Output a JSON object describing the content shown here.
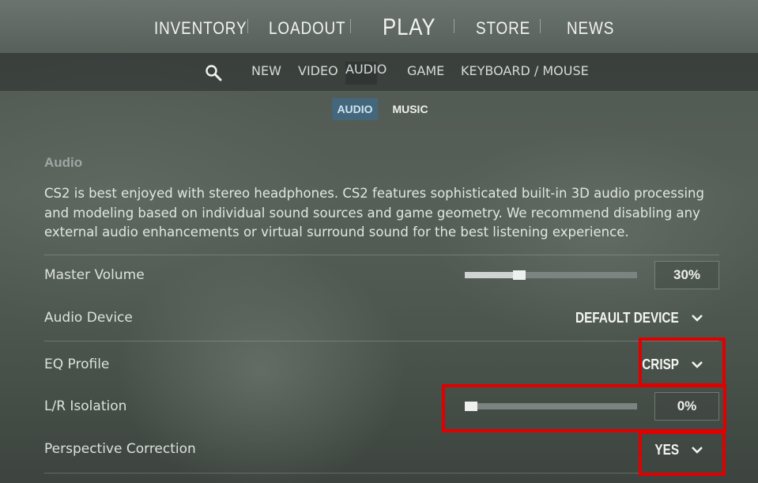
{
  "top_nav": {
    "items": [
      "INVENTORY",
      "LOADOUT",
      "PLAY",
      "STORE",
      "NEWS"
    ]
  },
  "settings_tabs": {
    "search_icon": "search-icon",
    "items": [
      "NEW",
      "VIDEO",
      "AUDIO",
      "GAME",
      "KEYBOARD / MOUSE"
    ],
    "active": "AUDIO"
  },
  "sub_tabs": {
    "items": [
      "AUDIO",
      "MUSIC"
    ],
    "active": "AUDIO"
  },
  "section": {
    "title": "Audio",
    "description": "CS2 is best enjoyed with stereo headphones. CS2 features sophisticated built-in 3D audio processing and modeling based on individual sound sources and game geometry. We recommend disabling any external audio enhancements or virtual surround sound for the best listening experience."
  },
  "settings": {
    "master_volume": {
      "label": "Master Volume",
      "value_text": "30%",
      "level": 0.3
    },
    "audio_device": {
      "label": "Audio Device",
      "value": "DEFAULT DEVICE"
    },
    "eq_profile": {
      "label": "EQ Profile",
      "value": "CRISP"
    },
    "lr_isolation": {
      "label": "L/R Isolation",
      "value_text": "0%",
      "level": 0.0
    },
    "perspective_correction": {
      "label": "Perspective Correction",
      "value": "YES"
    }
  },
  "colors": {
    "active_tab": "#44677c",
    "highlight": "#e00000"
  }
}
